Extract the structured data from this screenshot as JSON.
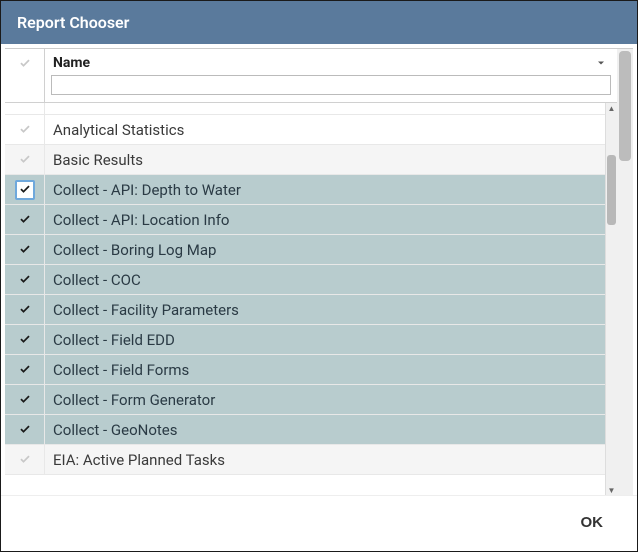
{
  "title": "Report Chooser",
  "columns": {
    "name_label": "Name",
    "filter_value": ""
  },
  "rows": [
    {
      "name": "",
      "checked": false,
      "selected": false,
      "partial": true
    },
    {
      "name": "Analytical Statistics",
      "checked": false,
      "selected": false
    },
    {
      "name": "Basic Results",
      "checked": false,
      "selected": false,
      "alt": true
    },
    {
      "name": "Collect - API: Depth to Water",
      "checked": true,
      "selected": true,
      "focus": true
    },
    {
      "name": "Collect - API: Location Info",
      "checked": true,
      "selected": true
    },
    {
      "name": "Collect - Boring Log Map",
      "checked": true,
      "selected": true
    },
    {
      "name": "Collect - COC",
      "checked": true,
      "selected": true
    },
    {
      "name": "Collect - Facility Parameters",
      "checked": true,
      "selected": true
    },
    {
      "name": "Collect - Field EDD",
      "checked": true,
      "selected": true
    },
    {
      "name": "Collect - Field Forms",
      "checked": true,
      "selected": true
    },
    {
      "name": "Collect - Form Generator",
      "checked": true,
      "selected": true
    },
    {
      "name": "Collect - GeoNotes",
      "checked": true,
      "selected": true
    },
    {
      "name": "EIA: Active Planned Tasks",
      "checked": false,
      "selected": false,
      "alt": true
    }
  ],
  "footer": {
    "ok_label": "OK"
  }
}
